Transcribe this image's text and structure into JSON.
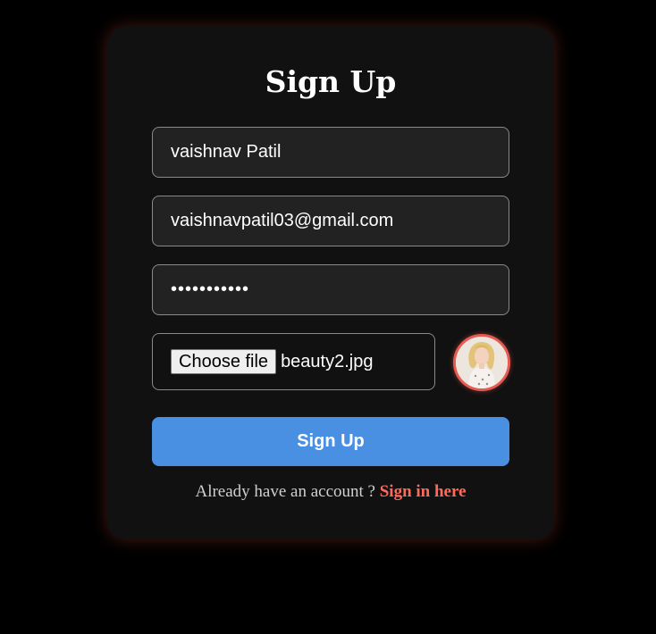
{
  "form": {
    "title": "Sign Up",
    "name_value": "vaishnav Patil",
    "email_value": "vaishnavpatil03@gmail.com",
    "password_value": "•••••••••••",
    "file_button_label": "Choose file",
    "file_name": "beauty2.jpg",
    "submit_label": "Sign Up",
    "footer_text": "Already have an account ? ",
    "signin_link": "Sign in here"
  },
  "colors": {
    "background": "#000000",
    "card": "#111111",
    "input_bg": "#222222",
    "accent_button": "#4a90e2",
    "link": "#ff6a5a",
    "avatar_border": "#e65a52"
  }
}
